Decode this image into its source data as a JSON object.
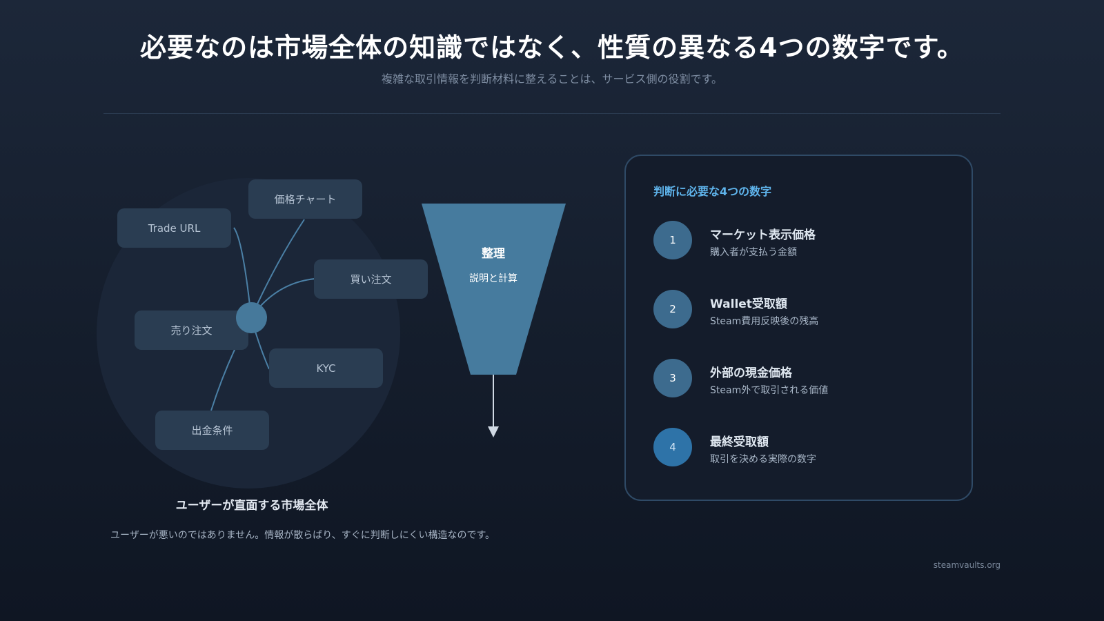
{
  "header": {
    "title": "必要なのは市場全体の知識ではなく、性質の異なる4つの数字です。",
    "subtitle": "複雑な取引情報を判断材料に整えることは、サービス側の役割です。"
  },
  "market": {
    "nodes": {
      "trade_url": "Trade URL",
      "price_chart": "価格チャート",
      "buy_order": "買い注文",
      "sell_order": "売り注文",
      "kyc": "KYC",
      "withdrawal": "出金条件"
    },
    "label": "ユーザーが直面する市場全体",
    "caption": "ユーザーが悪いのではありません。情報が散らばり、すぐに判断しにくい構造なのです。"
  },
  "funnel": {
    "title": "整理",
    "subtitle": "説明と計算"
  },
  "panel": {
    "title": "判断に必要な4つの数字",
    "items": [
      {
        "number": "1",
        "title": "マーケット表示価格",
        "desc": "購入者が支払う金額"
      },
      {
        "number": "2",
        "title": "Wallet受取額",
        "desc": "Steam費用反映後の残高"
      },
      {
        "number": "3",
        "title": "外部の現金価格",
        "desc": "Steam外で取引される価値"
      },
      {
        "number": "4",
        "title": "最終受取額",
        "desc": "取引を決める実際の数字"
      }
    ]
  },
  "footer": {
    "site": "steamvaults.org"
  },
  "colors": {
    "accent_blue": "#5fb4ec",
    "node_fill": "#2a3d52",
    "hub_fill": "#46799b",
    "funnel_fill": "#467b9e",
    "final_number_fill": "#2e73a8"
  }
}
